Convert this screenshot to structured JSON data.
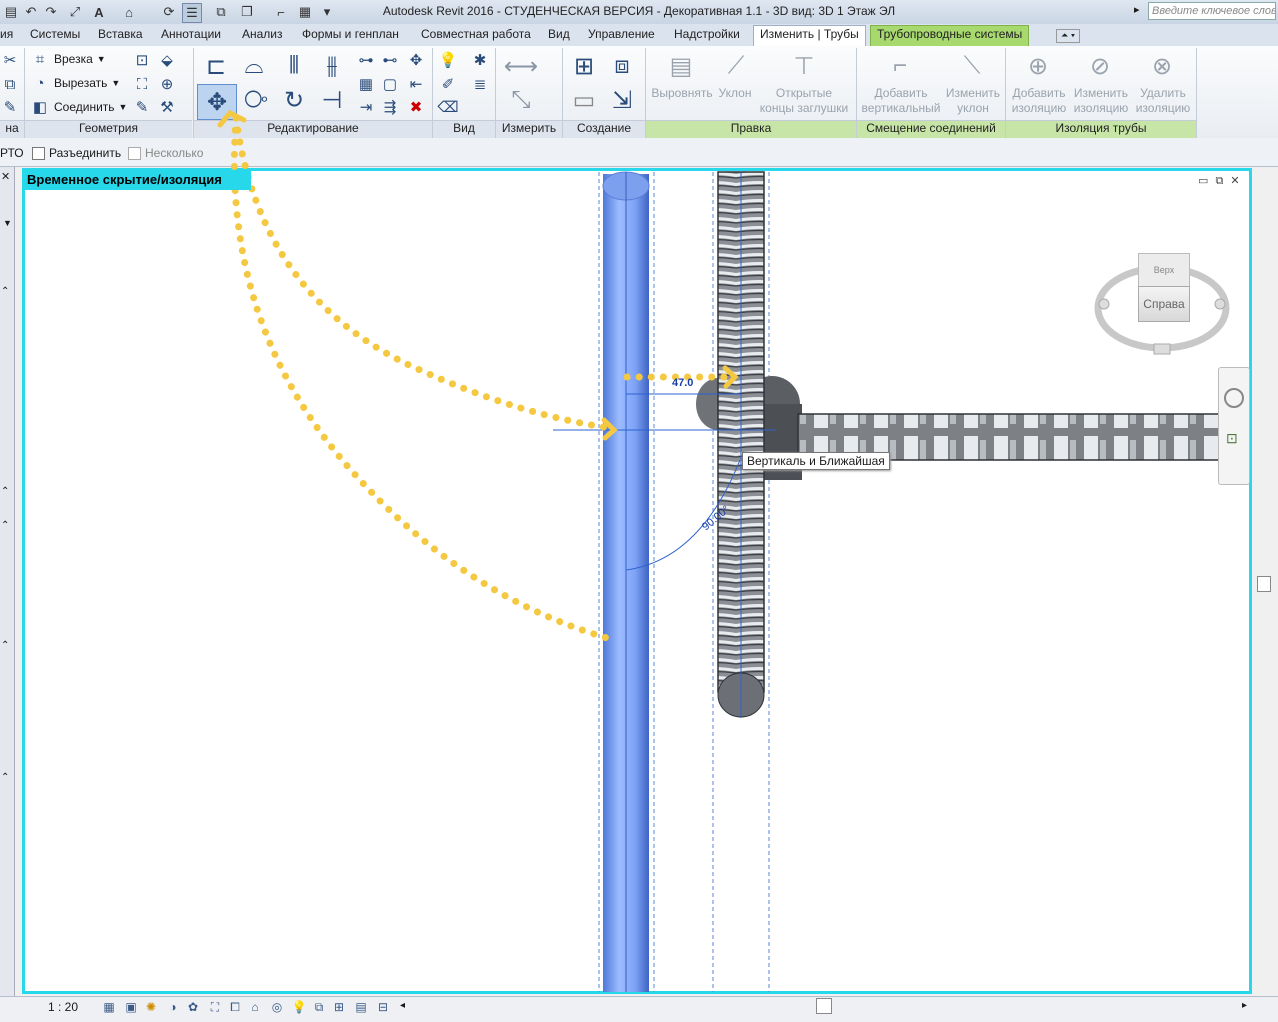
{
  "window": {
    "title": "Autodesk Revit 2016 - СТУДЕНЧЕСКАЯ ВЕРСИЯ -     Декоративная 1.1 - 3D вид: 3D 1 Этаж ЭЛ",
    "search_placeholder": "Введите ключевое слово"
  },
  "tabs": [
    {
      "label": "ия"
    },
    {
      "label": "Системы"
    },
    {
      "label": "Вставка"
    },
    {
      "label": "Аннотации"
    },
    {
      "label": "Анализ"
    },
    {
      "label": "Формы и генплан"
    },
    {
      "label": "Совместная работа"
    },
    {
      "label": "Вид"
    },
    {
      "label": "Управление"
    },
    {
      "label": "Надстройки"
    },
    {
      "label": "Изменить | Трубы"
    },
    {
      "label": "Трубопроводные системы"
    }
  ],
  "ribbon": {
    "geometry": {
      "label": "Геометрия",
      "items": [
        "Врезка",
        "Вырезать",
        "Соединить"
      ]
    },
    "left_label": "нa",
    "editing": {
      "label": "Редактирование"
    },
    "view": {
      "label": "Вид"
    },
    "measure": {
      "label": "Измерить"
    },
    "create": {
      "label": "Создание"
    },
    "correction": {
      "label": "Правка",
      "buttons": [
        {
          "line1": "Выровнять",
          "line2": ""
        },
        {
          "line1": "Уклон",
          "line2": ""
        },
        {
          "line1": "Открытые",
          "line2": "концы заглушки"
        }
      ]
    },
    "offset": {
      "label": "Смещение соединений",
      "buttons": [
        {
          "line1": "Добавить",
          "line2": "вертикальный"
        },
        {
          "line1": "Изменить",
          "line2": "уклон"
        }
      ]
    },
    "insulation": {
      "label": "Изоляция трубы",
      "buttons": [
        {
          "line1": "Добавить",
          "line2": "изоляцию"
        },
        {
          "line1": "Изменить",
          "line2": "изоляцию"
        },
        {
          "line1": "Удалить",
          "line2": "изоляцию"
        }
      ]
    }
  },
  "options_bar": {
    "prefix": "РТО",
    "disconnect": "Разъединить",
    "multiple": "Несколько"
  },
  "view": {
    "banner": "Временное скрытие/изоляция",
    "tooltip": "Вертикаль и Ближайшая",
    "dim_distance": "47.0",
    "dim_angle": "90.00°",
    "viewcube_face": "Справа",
    "viewcube_top": "Верх"
  },
  "status": {
    "scale": "1 : 20"
  },
  "colors": {
    "view_frame": "#27d7ea",
    "pipe_blue": "#8fb3ff",
    "annotation_arrow": "#f5c842",
    "context_tab": "#a8d96e"
  }
}
